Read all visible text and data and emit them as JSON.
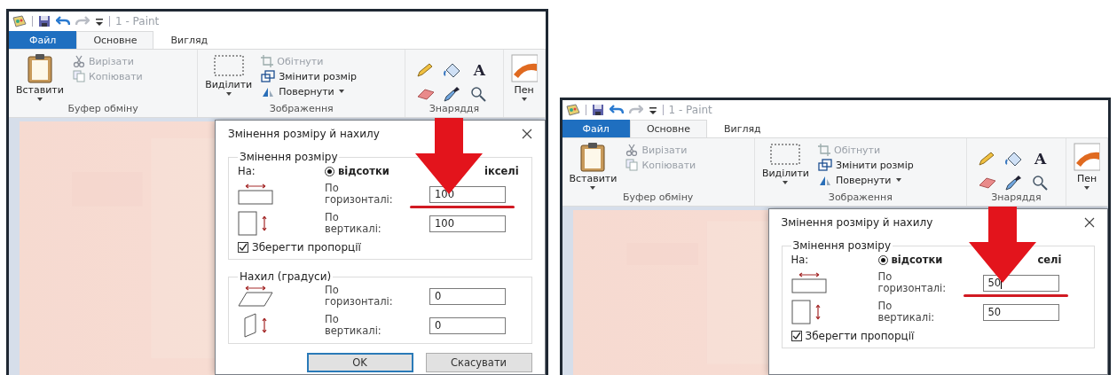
{
  "panels": [
    {
      "title": "1 - Paint",
      "tabs": [
        {
          "label": "Файл",
          "kind": "file",
          "selected": false
        },
        {
          "label": "Основне",
          "kind": "tab",
          "selected": true
        },
        {
          "label": "Вигляд",
          "kind": "tab",
          "selected": false
        }
      ],
      "ribbon": [
        {
          "kind": "clipboard",
          "label": "Буфер обміну",
          "large": {
            "label": "Вставити",
            "dropdown": true
          },
          "small": [
            {
              "kind": "cut",
              "label": "Вирізати",
              "disabled": true
            },
            {
              "kind": "copy",
              "label": "Копіювати",
              "disabled": true
            }
          ]
        },
        {
          "label": "Зображення",
          "large": {
            "label": "Виділити",
            "dropdown": true
          },
          "small": [
            {
              "kind": "crop",
              "label": "Обітнути",
              "disabled": true
            },
            {
              "kind": "resize",
              "label": "Змінити розмір",
              "disabled": false
            },
            {
              "kind": "rotate",
              "label": "Повернути",
              "disabled": false,
              "dropdown": true
            }
          ]
        },
        {
          "kind": "tools",
          "label": "Знаряддя",
          "text_glyph": "A"
        },
        {
          "kind": "brushes",
          "large": {
            "label": "Пен",
            "dropdown": true
          }
        }
      ],
      "canvas": {
        "kind": "picture"
      },
      "dialog": {
        "title": "Змінення розміру й нахилу",
        "sections": [
          {
            "kind": "resize",
            "legend": "Змінення розміру",
            "by_label": "На:",
            "option": {
              "label": "відсотки",
              "selected": true
            },
            "other_option_text": "ікселі",
            "fields": [
              {
                "kind": "horizontal",
                "label": "По горизонталі:",
                "value": "100",
                "underlined": true,
                "arrow": true,
                "focused": false
              },
              {
                "kind": "vertical",
                "label": "По вертикалі:",
                "value": "100",
                "underlined": false,
                "arrow": false,
                "focused": false
              }
            ],
            "checkbox": {
              "label": "Зберегти пропорції",
              "checked": true
            }
          },
          {
            "kind": "skew",
            "legend": "Нахил (градуси)",
            "fields": [
              {
                "kind": "skew_horizontal",
                "label": "По горизонталі:",
                "value": "0",
                "underlined": false,
                "arrow": false,
                "focused": false
              },
              {
                "kind": "skew_vertical",
                "label": "По вертикалі:",
                "value": "0",
                "underlined": false,
                "arrow": false,
                "focused": false
              }
            ]
          }
        ],
        "buttons": [
          {
            "label": "OK",
            "default": true
          },
          {
            "label": "Скасувати",
            "default": false
          }
        ]
      }
    },
    {
      "title": "1 - Paint",
      "tabs": [
        {
          "label": "Файл",
          "kind": "file",
          "selected": false
        },
        {
          "label": "Основне",
          "kind": "tab",
          "selected": true
        },
        {
          "label": "Вигляд",
          "kind": "tab",
          "selected": false
        }
      ],
      "ribbon": [
        {
          "kind": "clipboard",
          "label": "Буфер обміну",
          "large": {
            "label": "Вставити",
            "dropdown": true
          },
          "small": [
            {
              "kind": "cut",
              "label": "Вирізати",
              "disabled": true
            },
            {
              "kind": "copy",
              "label": "Копіювати",
              "disabled": true
            }
          ]
        },
        {
          "label": "Зображення",
          "large": {
            "label": "Виділити",
            "dropdown": true
          },
          "small": [
            {
              "kind": "crop",
              "label": "Обітнути",
              "disabled": true
            },
            {
              "kind": "resize",
              "label": "Змінити розмір",
              "disabled": false
            },
            {
              "kind": "rotate",
              "label": "Повернути",
              "disabled": false,
              "dropdown": true
            }
          ]
        },
        {
          "kind": "tools",
          "label": "Знаряддя",
          "text_glyph": "A"
        },
        {
          "kind": "brushes",
          "large": {
            "label": "Пен",
            "dropdown": true
          }
        }
      ],
      "canvas": {
        "kind": "picture"
      },
      "dialog": {
        "title": "Змінення розміру й нахилу",
        "sections": [
          {
            "kind": "resize",
            "legend": "Змінення розміру",
            "by_label": "На:",
            "option": {
              "label": "відсотки",
              "selected": true
            },
            "other_option_text": "селі",
            "fields": [
              {
                "kind": "horizontal",
                "label": "По горизонталі:",
                "value": "50",
                "underlined": true,
                "arrow": true,
                "focused": true
              },
              {
                "kind": "vertical",
                "label": "По вертикалі:",
                "value": "50",
                "underlined": false,
                "arrow": false,
                "focused": false
              }
            ],
            "checkbox": {
              "label": "Зберегти пропорції",
              "checked": true
            }
          }
        ]
      }
    }
  ]
}
